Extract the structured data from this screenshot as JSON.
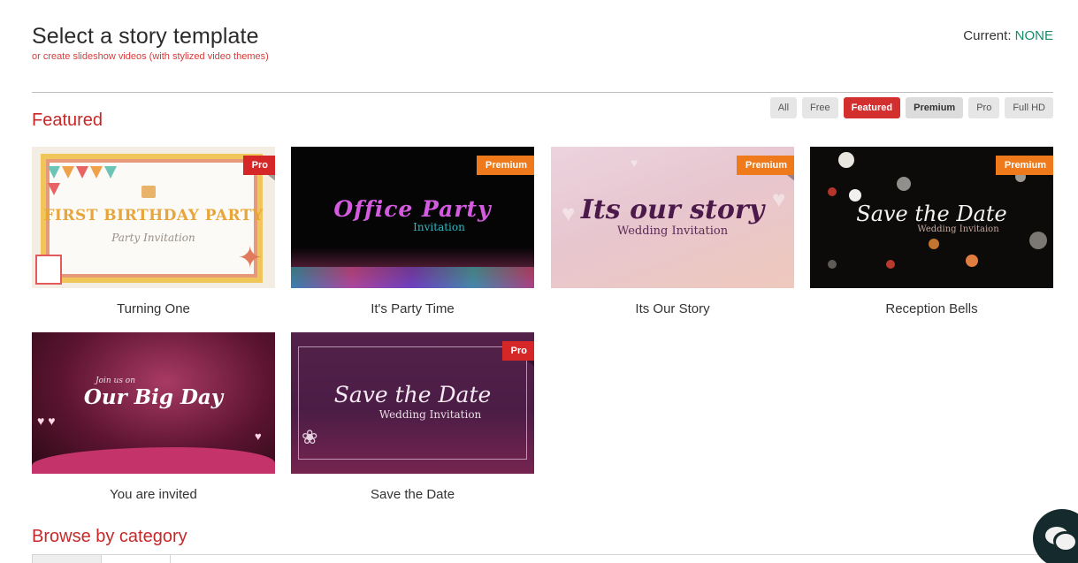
{
  "header": {
    "title": "Select a story template",
    "subtitle": "or create slideshow videos (with stylized video themes)",
    "current_label": "Current: ",
    "current_value": "NONE"
  },
  "filters": [
    {
      "label": "All",
      "active": false
    },
    {
      "label": "Free",
      "active": false
    },
    {
      "label": "Featured",
      "active": true
    },
    {
      "label": "Premium",
      "active": false
    },
    {
      "label": "Pro",
      "active": false
    },
    {
      "label": "Full HD",
      "active": false
    }
  ],
  "sections": {
    "featured": "Featured",
    "browse": "Browse by category"
  },
  "templates": [
    {
      "name": "Turning One",
      "badge": "Pro",
      "thumb_text": "FIRST BIRTHDAY PARTY",
      "thumb_sub": "Party Invitation"
    },
    {
      "name": "It's Party Time",
      "badge": "Premium",
      "thumb_text": "Office Party",
      "thumb_sub": "Invitation"
    },
    {
      "name": "Its Our Story",
      "badge": "Premium",
      "thumb_text": "Its our story",
      "thumb_sub": "Wedding Invitation"
    },
    {
      "name": "Reception Bells",
      "badge": "Premium",
      "thumb_text": "Save the Date",
      "thumb_sub": "Wedding Invitaion"
    },
    {
      "name": "You are invited",
      "badge": "",
      "thumb_pre": "Join us on",
      "thumb_text": "Our Big Day",
      "thumb_sub": ""
    },
    {
      "name": "Save the Date",
      "badge": "Pro",
      "thumb_text": "Save the Date",
      "thumb_sub": "Wedding Invitation"
    }
  ],
  "colors": {
    "accent_red": "#d32f2f",
    "premium_orange": "#ee7a1b",
    "current_green": "#1a8a6a"
  },
  "chat_widget": {
    "icon": "chat-bubbles-icon"
  }
}
